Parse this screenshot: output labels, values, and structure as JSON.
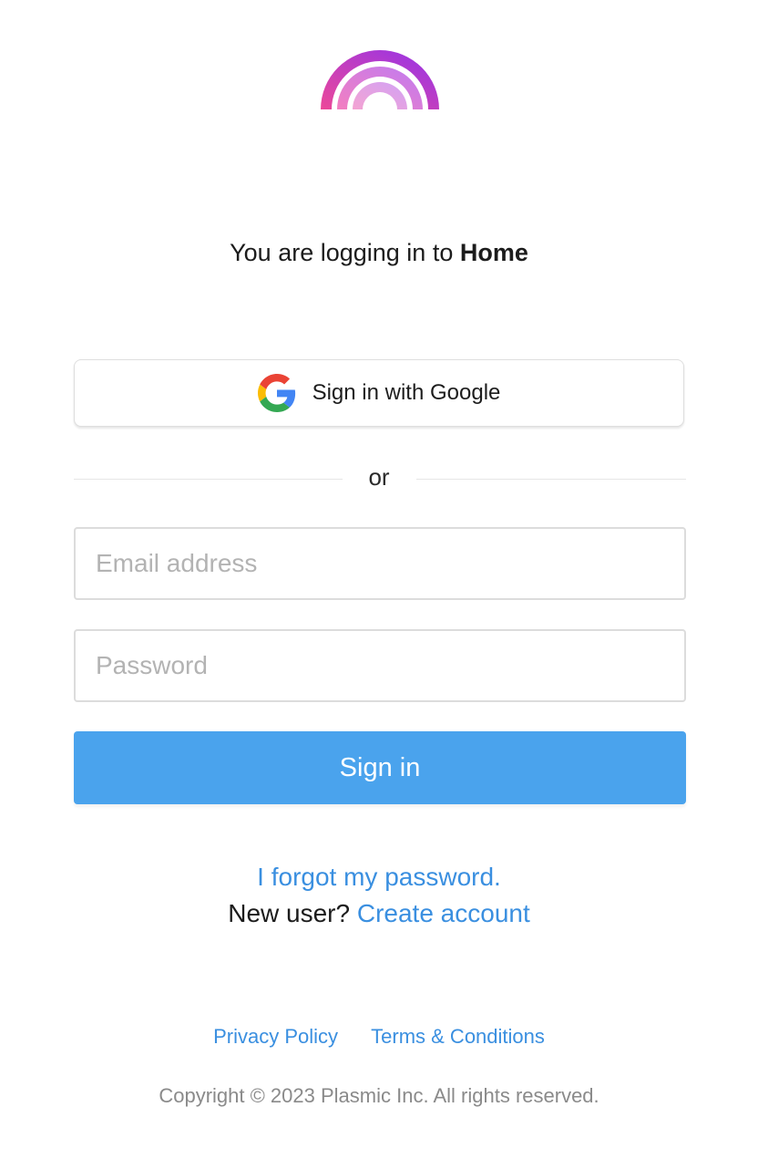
{
  "brand": {
    "logo_icon": "plasmic-rainbow-logo",
    "gradient_start": "#ec4899",
    "gradient_end": "#a855f7"
  },
  "heading": {
    "prefix": "You are logging in to ",
    "app_name": "Home"
  },
  "google": {
    "icon": "google-g-icon",
    "label": "Sign in with Google"
  },
  "divider": {
    "text": "or"
  },
  "form": {
    "email_placeholder": "Email address",
    "email_value": "",
    "password_placeholder": "Password",
    "password_value": "",
    "submit_label": "Sign in",
    "submit_color": "#4aa3ed"
  },
  "links": {
    "forgot_password": "I forgot my password.",
    "new_user_prefix": "New user?",
    "create_account": "Create account",
    "link_color": "#3a8fe0"
  },
  "footer": {
    "privacy": "Privacy Policy",
    "terms": "Terms & Conditions",
    "copyright": "Copyright © 2023 Plasmic Inc. All rights reserved."
  }
}
